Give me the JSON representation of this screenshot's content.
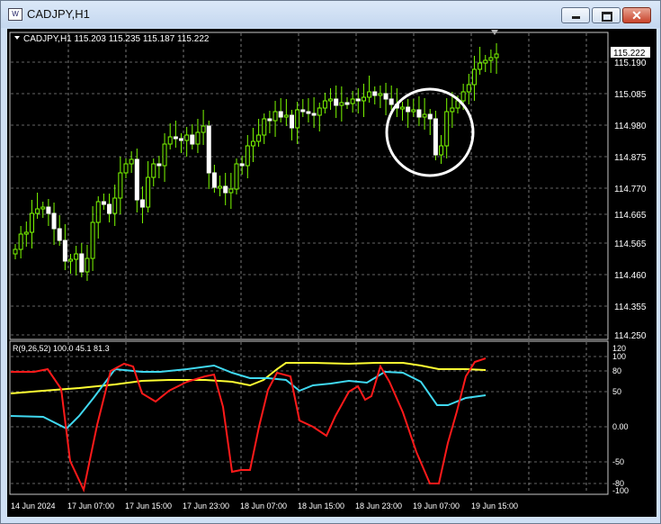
{
  "window": {
    "title": "CADJPY,H1",
    "app_icon_text": "W",
    "close_glyph": "✕"
  },
  "chart": {
    "header": "CADJPY,H1  115.203 115.235 115.187 115.222",
    "current_price": "115.222",
    "price_levels": [
      "115.190",
      "115.085",
      "114.980",
      "114.875",
      "114.770",
      "114.665",
      "114.565",
      "114.460",
      "114.355",
      "114.250"
    ],
    "time_labels": [
      "14 Jun 2024",
      "17 Jun 07:00",
      "17 Jun 15:00",
      "17 Jun 23:00",
      "18 Jun 07:00",
      "18 Jun 15:00",
      "18 Jun 23:00",
      "19 Jun 07:00",
      "19 Jun 15:00"
    ],
    "colors": {
      "background": "#000000",
      "candles": "#7cfc00",
      "highlight_circle": "#ffffff",
      "grid": "#c8c8c8"
    }
  },
  "indicator": {
    "header": "R(9,26,52) 100.0 45.1 81.3",
    "levels": [
      "120",
      "100",
      "80",
      "50",
      "0.00",
      "-50",
      "-80",
      "-100"
    ],
    "colors": {
      "red_line": "#ff1a1a",
      "yellow_line": "#ffff33",
      "cyan_line": "#40d8f0"
    }
  }
}
